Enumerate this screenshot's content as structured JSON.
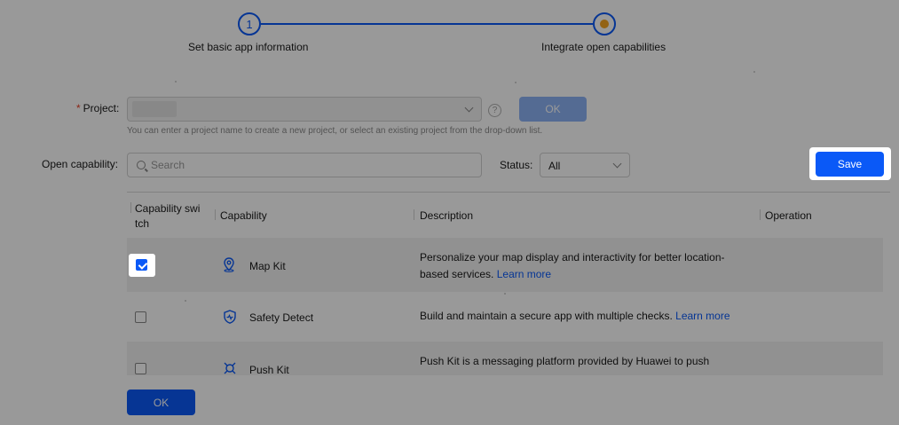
{
  "stepper": {
    "step1_number": "1",
    "step1_label": "Set basic app information",
    "step2_label": "Integrate open capabilities"
  },
  "project": {
    "required_mark": "*",
    "label": "Project:",
    "help_glyph": "?",
    "ok_label": "OK",
    "hint": "You can enter a project name to create a new project, or select an existing project from the drop-down list."
  },
  "capability_filter": {
    "label": "Open capability:",
    "search_placeholder": "Search",
    "status_label": "Status:",
    "status_value": "All"
  },
  "save_label": "Save",
  "table": {
    "headers": {
      "switch": "Capability swi tch",
      "capability": "Capability",
      "description": "Description",
      "operation": "Operation"
    },
    "rows": [
      {
        "icon": "map-pin-icon",
        "name": "Map Kit",
        "checked": true,
        "description": "Personalize your map display and interactivity for better location-based services. ",
        "link": "Learn more"
      },
      {
        "icon": "shield-icon",
        "name": "Safety Detect",
        "checked": false,
        "description": "Build and maintain a secure app with multiple checks. ",
        "link": "Learn more"
      },
      {
        "icon": "push-icon",
        "name": "Push Kit",
        "checked": false,
        "description": "Push Kit is a messaging platform provided by Huawei to push",
        "link": ""
      }
    ]
  },
  "footer_ok_label": "OK",
  "colors": {
    "accent": "#0a59f7",
    "step_dot": "#f5a623",
    "overlay": "rgba(0,0,0,0.40)"
  }
}
